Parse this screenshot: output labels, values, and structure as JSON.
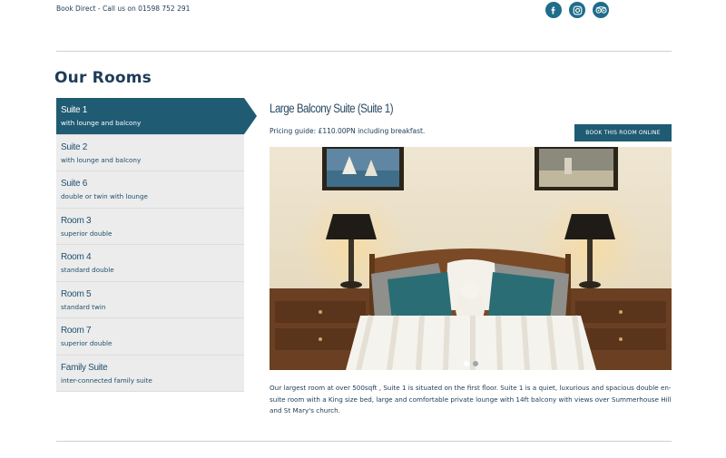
{
  "header": {
    "book_direct": "Book Direct - Call us on 01598 752 291",
    "social": [
      {
        "icon": "facebook-icon",
        "glyph": "f"
      },
      {
        "icon": "instagram-icon",
        "glyph": "◎"
      },
      {
        "icon": "tripadvisor-icon",
        "glyph": "⊙⊙"
      }
    ]
  },
  "page": {
    "title": "Our Rooms"
  },
  "sidebar": {
    "items": [
      {
        "name": "Suite 1",
        "desc": "with lounge and balcony"
      },
      {
        "name": "Suite 2",
        "desc": "with lounge and balcony"
      },
      {
        "name": "Suite 6",
        "desc": "double or twin with lounge"
      },
      {
        "name": "Room 3",
        "desc": "superior double"
      },
      {
        "name": "Room 4",
        "desc": "standard double"
      },
      {
        "name": "Room 5",
        "desc": "standard twin"
      },
      {
        "name": "Room 7",
        "desc": "superior double"
      },
      {
        "name": "Family Suite",
        "desc": "inter-connected family suite"
      }
    ]
  },
  "room": {
    "title": "Large Balcony Suite (Suite 1)",
    "pricing": "Pricing guide: £110.00PN including breakfast.",
    "book_button": "BOOK THIS ROOM ONLINE",
    "description": "Our largest room at over 500sqft , Suite 1 is situated on the first floor. Suite 1 is a quiet, luxurious and spacious double en-suite room with a King size bed, large and comfortable private lounge with 14ft balcony with views over Summerhouse Hill and St Mary's church."
  },
  "colors": {
    "accent": "#1f5b73",
    "title": "#1e3b59",
    "sidebar_bg": "#ececec"
  }
}
